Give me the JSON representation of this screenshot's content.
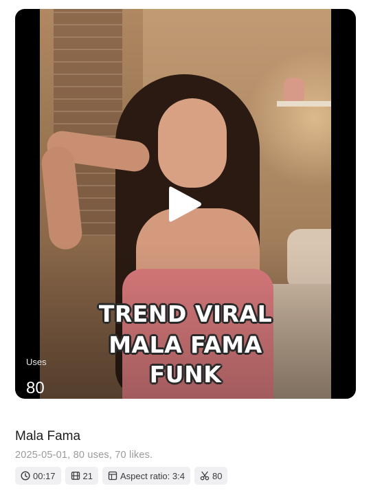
{
  "video": {
    "overlay_lines": [
      "TREND VIRAL",
      "MALA FAMA",
      "FUNK"
    ],
    "uses_label": "Uses",
    "uses_value": "80",
    "play_icon": "play-icon"
  },
  "template": {
    "title": "Mala Fama",
    "meta": "2025-05-01, 80 uses, 70 likes."
  },
  "chips": [
    {
      "icon": "clock-icon",
      "label": "00:17"
    },
    {
      "icon": "film-icon",
      "label": "21"
    },
    {
      "icon": "layout-icon",
      "label": "Aspect ratio: 3:4"
    },
    {
      "icon": "scissors-icon",
      "label": "80"
    }
  ],
  "colors": {
    "chip_bg": "#f0f0f2",
    "meta_text": "#9a9a9a",
    "title_text": "#1c1c1e"
  }
}
